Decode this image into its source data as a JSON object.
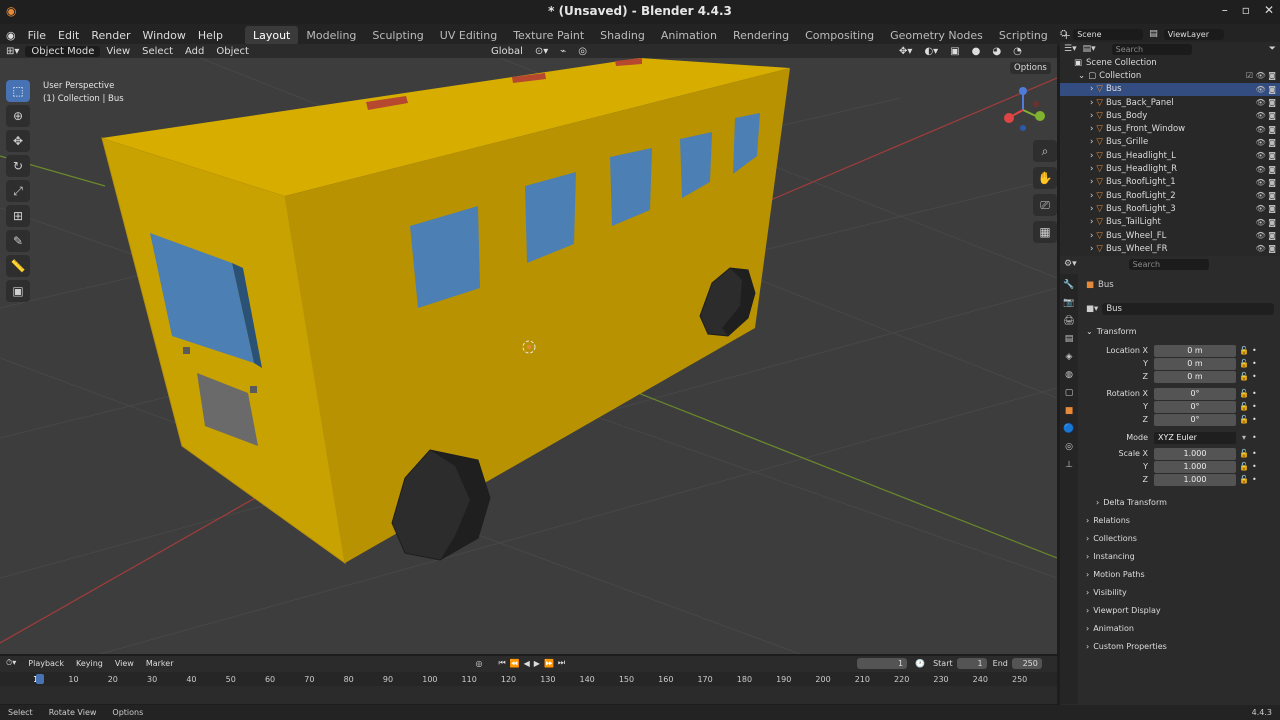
{
  "window_title": "* (Unsaved) - Blender 4.4.3",
  "menu": [
    "File",
    "Edit",
    "Render",
    "Window",
    "Help"
  ],
  "workspaces": [
    {
      "label": "Layout",
      "active": true
    },
    {
      "label": "Modeling"
    },
    {
      "label": "Sculpting"
    },
    {
      "label": "UV Editing"
    },
    {
      "label": "Texture Paint"
    },
    {
      "label": "Shading"
    },
    {
      "label": "Animation"
    },
    {
      "label": "Rendering"
    },
    {
      "label": "Compositing"
    },
    {
      "label": "Geometry Nodes"
    },
    {
      "label": "Scripting"
    }
  ],
  "scene_name": "Scene",
  "view_layer": "ViewLayer",
  "viewport_header": {
    "mode": "Object Mode",
    "menus": [
      "View",
      "Select",
      "Add",
      "Object"
    ],
    "transform_orientation": "Global",
    "options_label": "Options"
  },
  "viewport_overlay": {
    "perspective": "User Perspective",
    "collection_info": "(1) Collection | Bus"
  },
  "outliner": {
    "search_placeholder": "Search",
    "scene_collection": "Scene Collection",
    "collection": "Collection",
    "objects": [
      {
        "name": "Bus",
        "selected": true
      },
      {
        "name": "Bus_Back_Panel"
      },
      {
        "name": "Bus_Body"
      },
      {
        "name": "Bus_Front_Window"
      },
      {
        "name": "Bus_Grille"
      },
      {
        "name": "Bus_Headlight_L"
      },
      {
        "name": "Bus_Headlight_R"
      },
      {
        "name": "Bus_RoofLight_1"
      },
      {
        "name": "Bus_RoofLight_2"
      },
      {
        "name": "Bus_RoofLight_3"
      },
      {
        "name": "Bus_TailLight"
      },
      {
        "name": "Bus_Wheel_FL"
      },
      {
        "name": "Bus_Wheel_FR"
      }
    ]
  },
  "properties": {
    "search_placeholder": "Search",
    "object_name": "Bus",
    "object_field": "Bus",
    "transform_label": "Transform",
    "location": {
      "label": "Location X",
      "x": "0 m",
      "y": "0 m",
      "z": "0 m"
    },
    "rotation": {
      "label": "Rotation X",
      "x": "0°",
      "y": "0°",
      "z": "0°"
    },
    "mode_label": "Mode",
    "mode_value": "XYZ Euler",
    "scale": {
      "label": "Scale X",
      "x": "1.000",
      "y": "1.000",
      "z": "1.000"
    },
    "axis_y": "Y",
    "axis_z": "Z",
    "delta_transform": "Delta Transform",
    "sections": [
      "Relations",
      "Collections",
      "Instancing",
      "Motion Paths",
      "Visibility",
      "Viewport Display",
      "Animation",
      "Custom Properties"
    ]
  },
  "timeline": {
    "menus": [
      "Playback",
      "Keying",
      "View",
      "Marker"
    ],
    "current_frame": "1",
    "start_label": "Start",
    "start": "1",
    "end_label": "End",
    "end": "250",
    "ticks": [
      "1",
      "10",
      "20",
      "30",
      "40",
      "50",
      "60",
      "70",
      "80",
      "90",
      "100",
      "110",
      "120",
      "130",
      "140",
      "150",
      "160",
      "170",
      "180",
      "190",
      "200",
      "210",
      "220",
      "230",
      "240",
      "250"
    ]
  },
  "statusbar": {
    "items": [
      "Select",
      "Rotate View",
      "Options"
    ],
    "version": "4.4.3"
  }
}
